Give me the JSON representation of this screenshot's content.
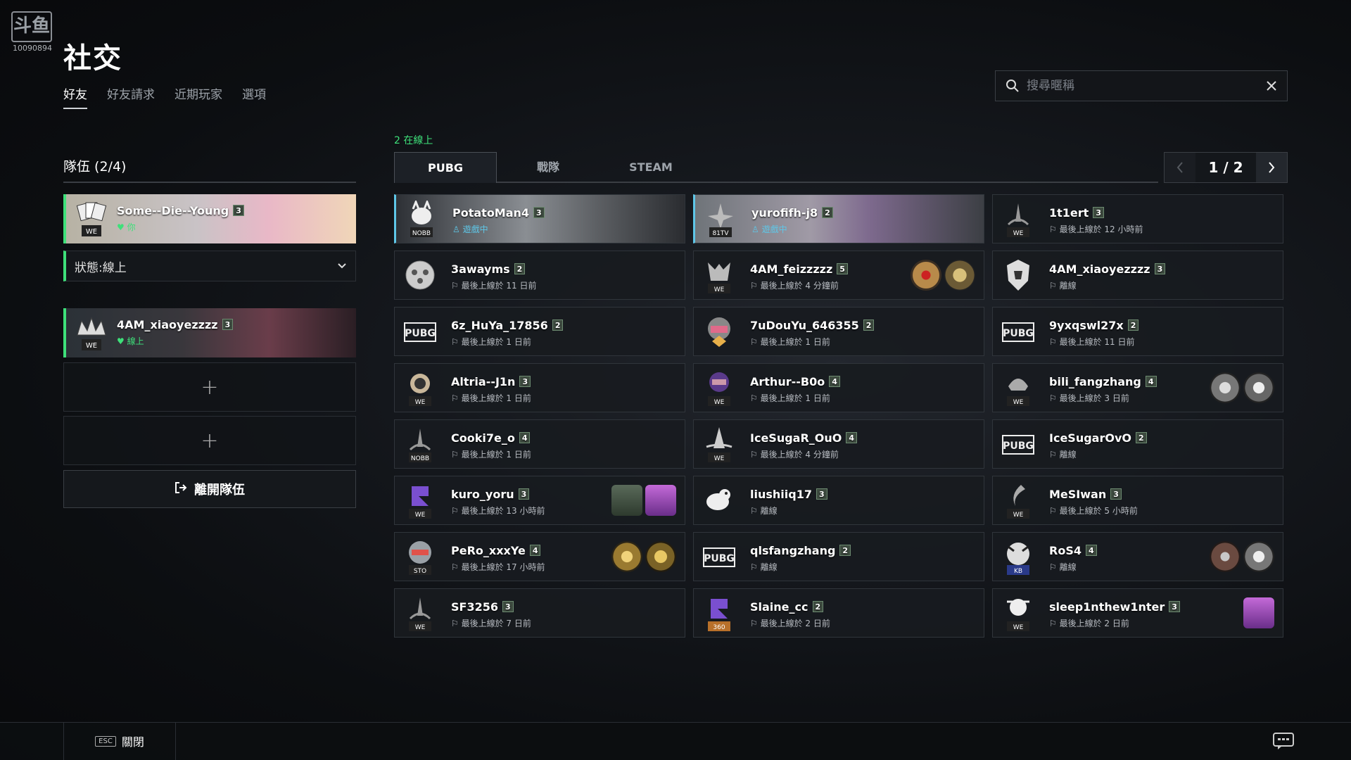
{
  "watermark": {
    "logo": "斗鱼",
    "room": "10090894"
  },
  "page": {
    "title": "社交"
  },
  "top_tabs": [
    "好友",
    "好友請求",
    "近期玩家",
    "選項"
  ],
  "search": {
    "placeholder": "搜尋暱稱"
  },
  "party": {
    "title": "隊伍 (2/4)",
    "members": [
      {
        "name": "Some--Die--Young",
        "level": "3",
        "status": "你"
      },
      {
        "name": "4AM_xiaoyezzzz",
        "level": "3",
        "status": "線上"
      }
    ],
    "status_select": "狀態:線上",
    "slot_plus": "+",
    "leave_label": "離開隊伍"
  },
  "friends": {
    "online_count": "2 在線上",
    "tabs": [
      "PUBG",
      "戰隊",
      "STEAM"
    ],
    "page": "1 / 2",
    "rows": [
      [
        {
          "name": "PotatoMan4",
          "level": "3",
          "status": "遊戲中"
        },
        {
          "name": "yurofifh-j8",
          "level": "2",
          "status": "遊戲中"
        },
        {
          "name": "1t1ert",
          "level": "3",
          "status": "最後上線於 12 小時前"
        }
      ],
      [
        {
          "name": "3awayms",
          "level": "2",
          "status": "最後上線於 11 日前"
        },
        {
          "name": "4AM_feizzzzz",
          "level": "5",
          "status": "最後上線於 4 分鐘前"
        },
        {
          "name": "4AM_xiaoyezzzz",
          "level": "3",
          "status": "離線"
        }
      ],
      [
        {
          "name": "6z_HuYa_17856",
          "level": "2",
          "status": "最後上線於 1 日前"
        },
        {
          "name": "7uDouYu_646355",
          "level": "2",
          "status": "最後上線於 1 日前"
        },
        {
          "name": "9yxqswl27x",
          "level": "2",
          "status": "最後上線於 11 日前"
        }
      ],
      [
        {
          "name": "Altria--J1n",
          "level": "3",
          "status": "最後上線於 1 日前"
        },
        {
          "name": "Arthur--B0o",
          "level": "4",
          "status": "最後上線於 1 日前"
        },
        {
          "name": "bili_fangzhang",
          "level": "4",
          "status": "最後上線於 3 日前"
        }
      ],
      [
        {
          "name": "Cooki7e_o",
          "level": "4",
          "status": "最後上線於 1 日前"
        },
        {
          "name": "IceSugaR_OuO",
          "level": "4",
          "status": "最後上線於 4 分鐘前"
        },
        {
          "name": "IceSugarOvO",
          "level": "2",
          "status": "離線"
        }
      ],
      [
        {
          "name": "kuro_yoru",
          "level": "3",
          "status": "最後上線於 13 小時前"
        },
        {
          "name": "liushiiq17",
          "level": "3",
          "status": "離線"
        },
        {
          "name": "MeSIwan",
          "level": "3",
          "status": "最後上線於 5 小時前"
        }
      ],
      [
        {
          "name": "PeRo_xxxYe",
          "level": "4",
          "status": "最後上線於 17 小時前"
        },
        {
          "name": "qlsfangzhang",
          "level": "2",
          "status": "離線"
        },
        {
          "name": "RoS4",
          "level": "4",
          "status": "離線"
        }
      ],
      [
        {
          "name": "SF3256",
          "level": "3",
          "status": "最後上線於 7 日前"
        },
        {
          "name": "Slaine_cc",
          "level": "2",
          "status": "最後上線於 2 日前"
        },
        {
          "name": "sleep1nthew1nter",
          "level": "3",
          "status": "最後上線於 2 日前"
        }
      ]
    ],
    "avatar_tags": [
      "WE",
      "NOBB",
      "81TV",
      "STO",
      "KB",
      "360"
    ]
  },
  "footer": {
    "esc": "ESC",
    "close_label": "關閉"
  },
  "colors": {
    "online": "#3ee07a",
    "playing": "#5ec7e8",
    "background": "#0c0e11"
  }
}
